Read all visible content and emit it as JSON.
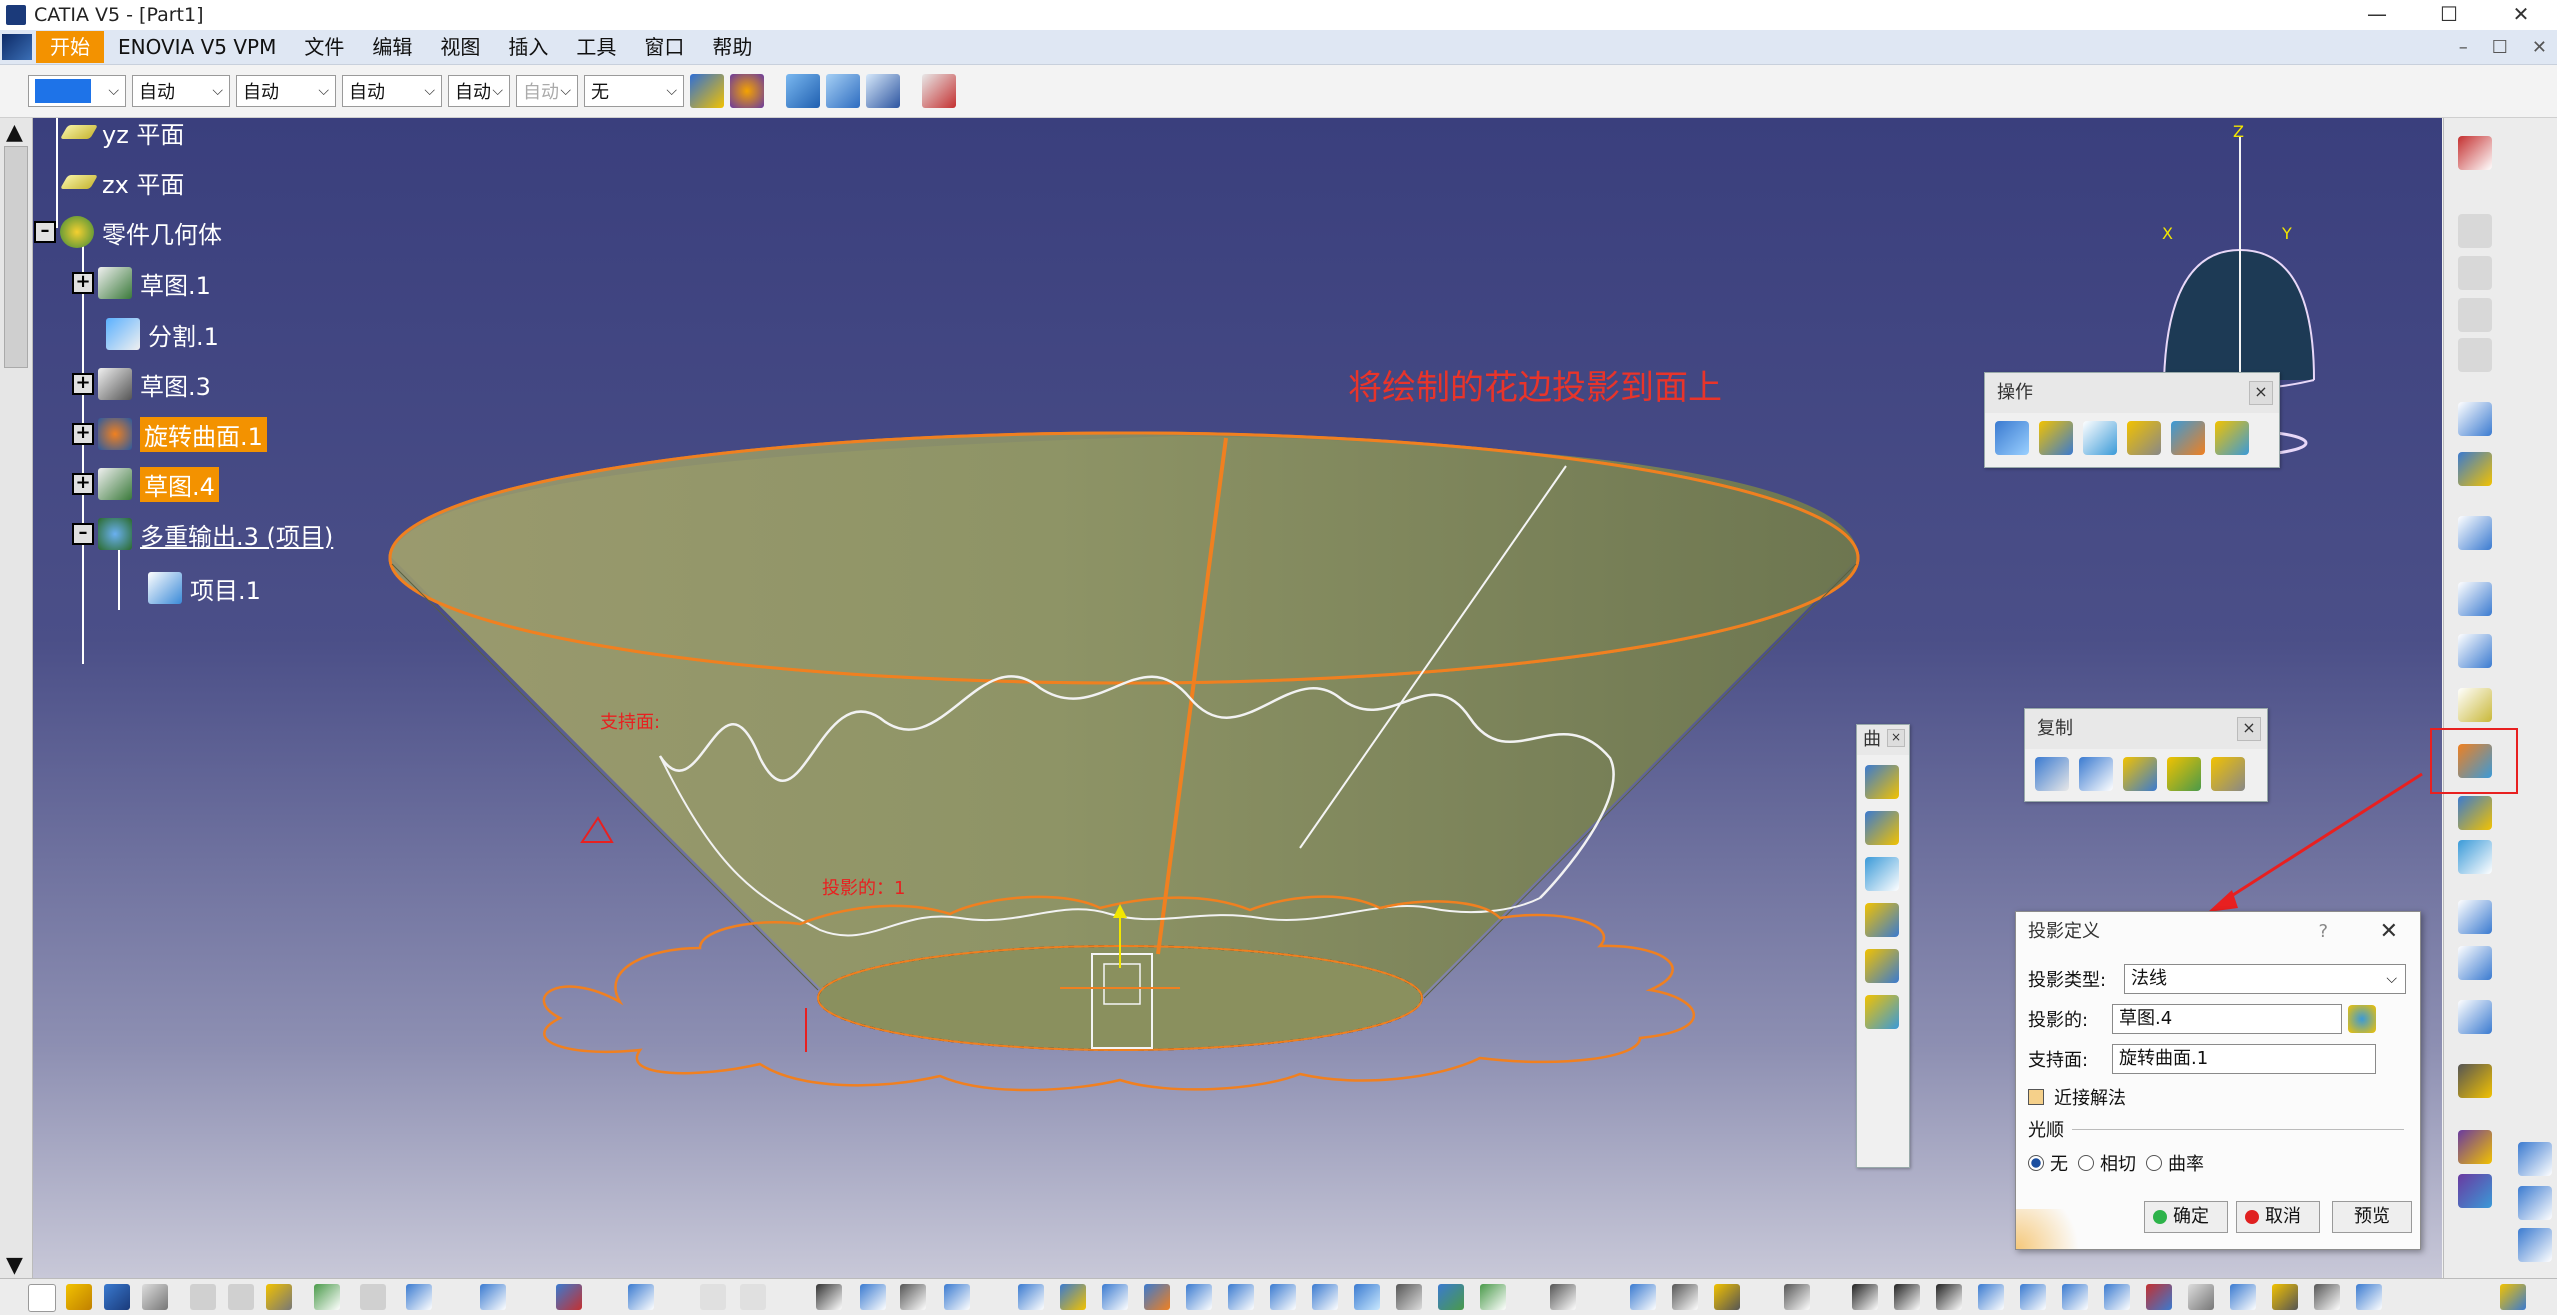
{
  "window": {
    "title": "CATIA V5 - [Part1]",
    "controls": [
      "—",
      "☐",
      "✕"
    ]
  },
  "menu": {
    "items": [
      "开始",
      "ENOVIA V5 VPM",
      "文件",
      "编辑",
      "视图",
      "插入",
      "工具",
      "窗口",
      "帮助"
    ],
    "active_index": 0,
    "mdi_controls": [
      "–",
      "☐",
      "✕"
    ]
  },
  "toolbar": {
    "color_swatch": "#1e73e8",
    "combo1": "自动",
    "combo2": "自动",
    "combo3": "自动",
    "combo4": "自动",
    "combo5": "自动",
    "combo6": "无"
  },
  "tree": {
    "nodes": [
      {
        "label": "yz 平面",
        "icon": "plane-icon",
        "hl": false
      },
      {
        "label": "zx 平面",
        "icon": "plane-icon",
        "hl": false
      },
      {
        "label": "零件几何体",
        "icon": "body-icon",
        "hl": false
      },
      {
        "label": "草图.1",
        "icon": "sketch-icon",
        "hl": false
      },
      {
        "label": "分割.1",
        "icon": "split-icon",
        "hl": false
      },
      {
        "label": "草图.3",
        "icon": "sketch-icon",
        "hl": false
      },
      {
        "label": "旋转曲面.1",
        "icon": "revolve-icon",
        "hl": true
      },
      {
        "label": "草图.4",
        "icon": "sketch-icon",
        "hl": true
      },
      {
        "label": "多重输出.3 (项目)",
        "icon": "multi-output-icon",
        "hl": false
      },
      {
        "label": "项目.1",
        "icon": "projection-icon",
        "hl": false
      }
    ]
  },
  "annotation": "将绘制的花边投影到面上",
  "compass_labels": {
    "z": "Z",
    "x": "X",
    "y": "Y"
  },
  "viewport_labels": {
    "support": "支持面:",
    "projection": "投影的：1"
  },
  "panel_operation": {
    "title": "操作"
  },
  "panel_copy": {
    "title": "复制"
  },
  "panel_small": {
    "title": "曲"
  },
  "dialog": {
    "title": "投影定义",
    "help": "?",
    "close": "✕",
    "type_label": "投影类型:",
    "type_value": "法线",
    "projected_label": "投影的:",
    "projected_value": "草图.4",
    "support_label": "支持面:",
    "support_value": "旋转曲面.1",
    "nearest_label": "近接解法",
    "smoothing_label": "光顺",
    "opt_none": "无",
    "opt_tangent": "相切",
    "opt_curvature": "曲率",
    "ok": "确定",
    "cancel": "取消",
    "preview": "预览"
  }
}
